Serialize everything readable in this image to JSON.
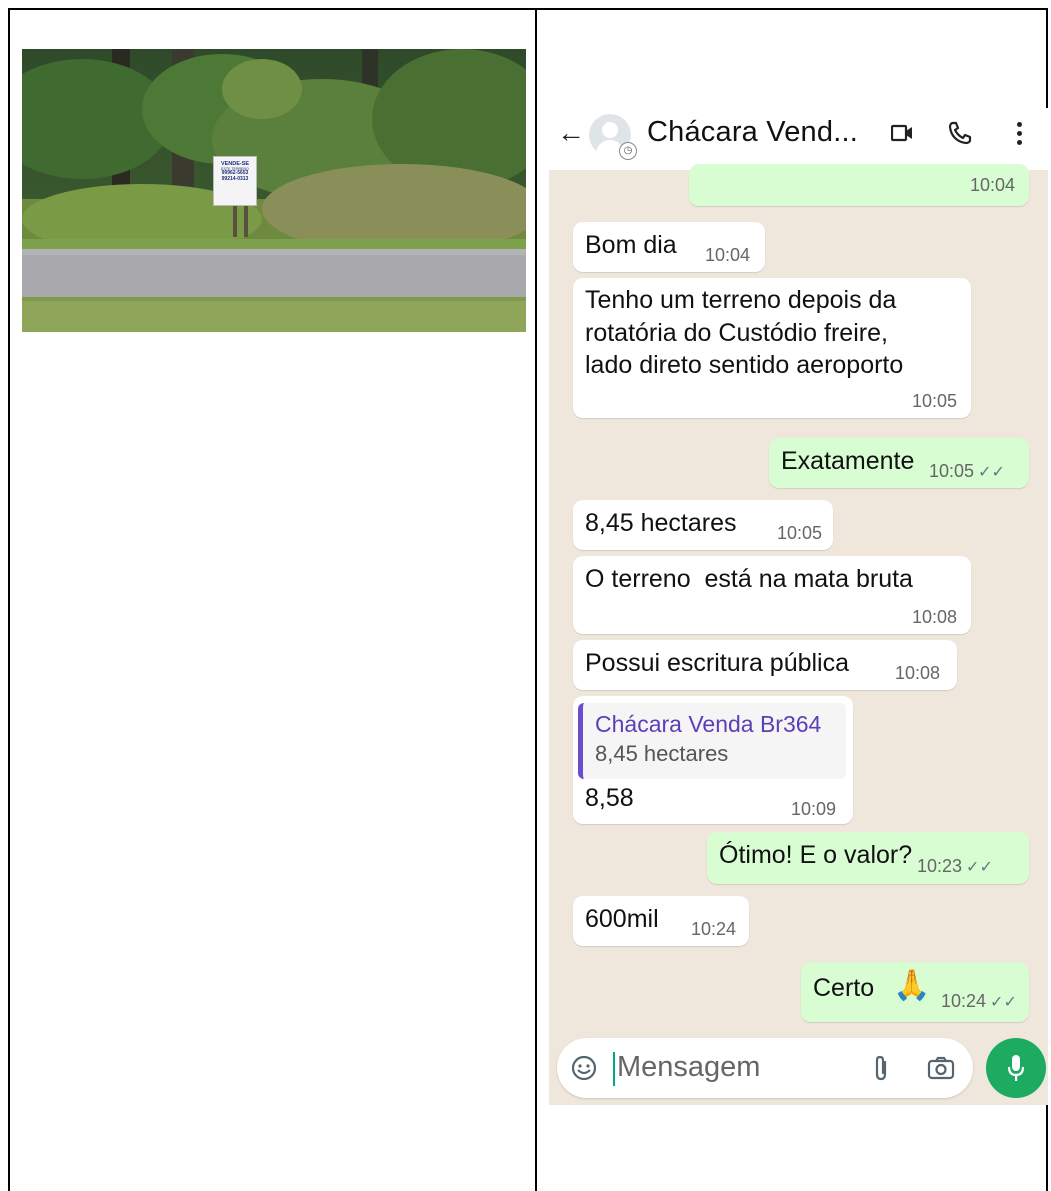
{
  "photo": {
    "sign_line1": "VENDE-SE",
    "sign_line2": "ESTE TERRENO",
    "sign_phone1": "99962-5653",
    "sign_phone2": "99214-0313"
  },
  "chat": {
    "title": "Chácara Vend...",
    "icons": {
      "back": "arrow-left-icon",
      "video": "video-call-icon",
      "phone": "phone-call-icon",
      "menu": "more-vertical-icon"
    },
    "messages": [
      {
        "dir": "out",
        "text": "",
        "time": "10:04"
      },
      {
        "dir": "in",
        "text": "Bom dia",
        "time": "10:04"
      },
      {
        "dir": "in",
        "lines": [
          "Tenho um terreno depois da",
          "rotatória do Custódio freire,",
          "lado direto sentido aeroporto"
        ],
        "time": "10:05"
      },
      {
        "dir": "out",
        "text": "Exatamente",
        "time": "10:05",
        "ticks": "✓✓"
      },
      {
        "dir": "in",
        "text": "8,45 hectares",
        "time": "10:05"
      },
      {
        "dir": "in",
        "text": "O terreno  está na mata bruta",
        "time": "10:08"
      },
      {
        "dir": "in",
        "text": "Possui escritura pública",
        "time": "10:08"
      },
      {
        "dir": "in",
        "quote_name": "Chácara Venda Br364",
        "quote_text": "8,45 hectares",
        "text": "8,58",
        "time": "10:09"
      },
      {
        "dir": "out",
        "text": "Ótimo! E o valor?",
        "time": "10:23",
        "ticks": "✓✓"
      },
      {
        "dir": "in",
        "text": "600mil",
        "time": "10:24"
      },
      {
        "dir": "out",
        "text": "Certo",
        "emoji": "🙏",
        "time": "10:24",
        "ticks": "✓✓"
      }
    ],
    "input": {
      "placeholder": "Mensagem"
    },
    "colors": {
      "header": "#ffffff",
      "wallpaper": "#efe7dc",
      "incoming": "#ffffff",
      "outgoing": "#d9fdd3",
      "mic": "#1daa61",
      "quote_bar": "#6a4ccf"
    }
  }
}
